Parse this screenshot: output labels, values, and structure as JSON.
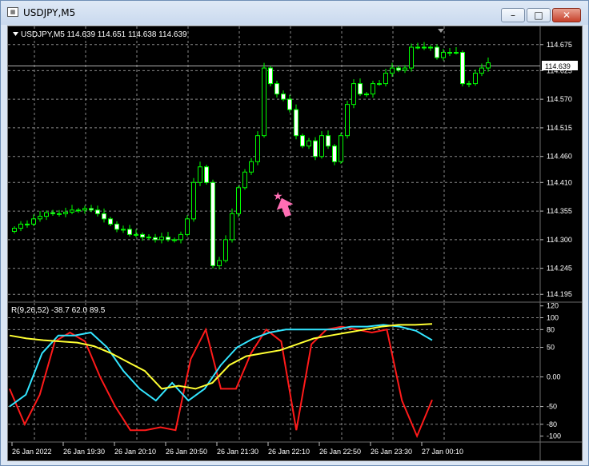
{
  "window": {
    "title": "USDJPY,M5",
    "minimize_label": "–",
    "maximize_label": "□",
    "close_label": "✕",
    "app_icon": "chart-window-icon"
  },
  "main_chart": {
    "header": "USDJPY,M5  114.639 114.651 114.638 114.639",
    "current_price_label": "114.639",
    "price_ticks": [
      "114.675",
      "114.625",
      "114.570",
      "114.515",
      "114.460",
      "114.410",
      "114.355",
      "114.300",
      "114.245",
      "114.195"
    ],
    "candle_up_color": "#00ff00",
    "candle_down_color": "#ffffff",
    "arrow_color": "#ff6eb4",
    "arrow_icon": "buy-arrow-icon",
    "star_icon": "star-icon"
  },
  "indicator": {
    "header": "R(9,26,52) -38.7 62.0 89.5",
    "ticks": [
      "120",
      "100",
      "80",
      "50",
      "0.00",
      "-50",
      "-80",
      "-100"
    ],
    "line_colors": [
      "#ff1a1a",
      "#33e5ff",
      "#ffff33"
    ]
  },
  "time_axis": {
    "labels": [
      "26 Jan 2022",
      "26 Jan 19:30",
      "26 Jan 20:10",
      "26 Jan 20:50",
      "26 Jan 21:30",
      "26 Jan 22:10",
      "26 Jan 22:50",
      "26 Jan 23:30",
      "27 Jan 00:10"
    ]
  },
  "chart_data": [
    {
      "type": "line",
      "title": "USDJPY,M5",
      "series": [
        {
          "name": "USDJPY,M5",
          "close": [
            114.322,
            114.33,
            114.33,
            114.34,
            114.345,
            114.352,
            114.35,
            114.35,
            114.353,
            114.357,
            114.357,
            114.36,
            114.357,
            114.35,
            114.34,
            114.33,
            114.32,
            114.32,
            114.31,
            114.31,
            114.305,
            114.304,
            114.3,
            114.305,
            114.3,
            114.3,
            114.31,
            114.34,
            114.41,
            114.44,
            114.41,
            114.25,
            114.26,
            114.3,
            114.35,
            114.4,
            114.43,
            114.45,
            114.5,
            114.63,
            114.6,
            114.58,
            114.57,
            114.55,
            114.5,
            114.48,
            114.49,
            114.46,
            114.5,
            114.48,
            114.45,
            114.5,
            114.56,
            114.6,
            114.58,
            114.58,
            114.6,
            114.6,
            114.62,
            114.63,
            114.626,
            114.63,
            114.67,
            114.67,
            114.67,
            114.67,
            114.65,
            114.66,
            114.66,
            114.66,
            114.6,
            114.6,
            114.62,
            114.63,
            114.64
          ]
        }
      ],
      "ylim": [
        114.18,
        114.71
      ]
    },
    {
      "type": "line",
      "title": "R(9,26,52)",
      "x": [
        "26 Jan 2022",
        "26 Jan 19:30",
        "26 Jan 20:10",
        "26 Jan 20:50",
        "26 Jan 21:30",
        "26 Jan 22:10",
        "26 Jan 22:50",
        "26 Jan 23:30",
        "27 Jan 00:10"
      ],
      "series": [
        {
          "values": [
            -20,
            -80,
            -30,
            60,
            75,
            60,
            0,
            -50,
            -90,
            -90,
            -85,
            -90,
            30,
            80,
            -20,
            -20,
            40,
            80,
            60,
            -90,
            55,
            80,
            85,
            80,
            75,
            80,
            -40,
            -100,
            -38.7
          ]
        },
        {
          "values": [
            -50,
            -30,
            40,
            70,
            70,
            75,
            50,
            10,
            -20,
            -40,
            -10,
            -40,
            -20,
            20,
            50,
            65,
            75,
            80,
            80,
            80,
            80,
            85,
            85,
            88,
            85,
            78,
            62
          ]
        },
        {
          "values": [
            70,
            65,
            62,
            60,
            58,
            52,
            40,
            25,
            10,
            -20,
            -15,
            -20,
            -10,
            20,
            35,
            40,
            45,
            55,
            65,
            70,
            75,
            80,
            85,
            88,
            88,
            89.5
          ]
        }
      ],
      "ylim": [
        -110,
        125
      ]
    }
  ]
}
